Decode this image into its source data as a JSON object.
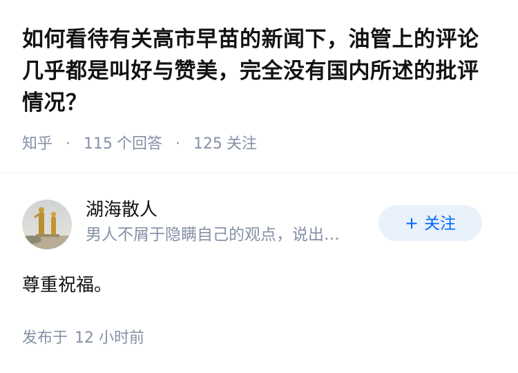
{
  "question": {
    "title": "如何看待有关高市早苗的新闻下，油管上的评论几乎都是叫好与赞美，完全没有国内所述的批评情况？",
    "source": "知乎",
    "dot": "·",
    "answers_count": "115",
    "answers_label": "个回答",
    "followers_count": "125",
    "followers_label": "关注"
  },
  "answer": {
    "author_name": "湖海散人",
    "author_bio": "男人不屑于隐瞒自己的观点，说出…",
    "follow_plus": "+",
    "follow_label": "关注",
    "content": "尊重祝福。",
    "posted_prefix": "发布于",
    "posted_time": "12 小时前"
  },
  "colors": {
    "title": "#121212",
    "meta": "#8590a6",
    "follow_bg": "#e9f1fb",
    "follow_text": "#0066ff"
  }
}
